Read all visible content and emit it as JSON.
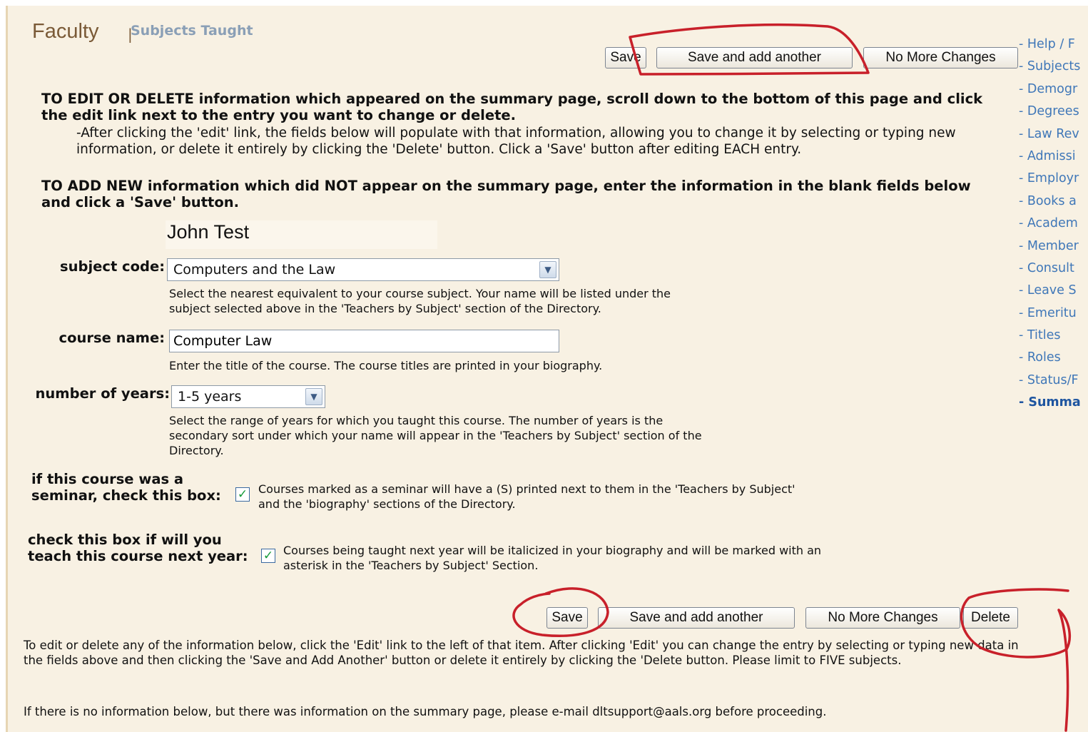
{
  "header": {
    "title": "Faculty",
    "separator": "|",
    "subtitle": "Subjects Taught"
  },
  "top_buttons": {
    "save": "Save",
    "save_add": "Save and add another",
    "no_more": "No More Changes"
  },
  "instructions": {
    "edit_bold": "TO EDIT OR DELETE information which appeared on the summary page, scroll down to the bottom of this page and click the edit link next to the entry you want to change or delete.",
    "edit_detail": "-After clicking the 'edit' link, the fields below will populate with that information, allowing you to change it by selecting or typing new information, or delete it entirely by clicking the 'Delete' button. Click a 'Save' button after editing EACH entry.",
    "add_bold": "TO ADD NEW information which did NOT appear on the summary page, enter the information in the blank fields below and click a 'Save' button."
  },
  "person_name": "John Test",
  "form": {
    "subject_code": {
      "label": "subject code:",
      "value": "Computers and the Law",
      "help": "Select the nearest equivalent to your course subject. Your name will be listed under the subject selected above in the 'Teachers by Subject' section of the Directory."
    },
    "course_name": {
      "label": "course name:",
      "value": "Computer Law",
      "help": "Enter the title of the course. The course titles are printed in your biography."
    },
    "years": {
      "label": "number of years:",
      "value": "1-5 years",
      "help": "Select the range of years for which you taught this course. The number of years is the secondary sort under which your name will appear in the 'Teachers by Subject' section of the Directory."
    },
    "seminar": {
      "label_line1": "if this course was a",
      "label_line2": "seminar, check this box:",
      "checked": true,
      "help": "Courses marked as a seminar will have a (S) printed next to them in the 'Teachers by Subject' and the 'biography' sections of the Directory."
    },
    "next_year": {
      "label_line1": "check this box if will you",
      "label_line2": "teach this course next year:",
      "checked": true,
      "help": "Courses being taught next year will be italicized in your biography and will be marked with an asterisk in the 'Teachers by Subject' Section."
    }
  },
  "bottom_buttons": {
    "save": "Save",
    "save_add": "Save and add another",
    "no_more": "No More Changes",
    "delete": "Delete"
  },
  "footer": {
    "edit_note": "To edit or delete any of the information below, click the 'Edit' link to the left of that item. After clicking 'Edit' you can change the entry by selecting or typing new data in the fields above and then clicking the 'Save and Add Another' button or delete it entirely by clicking the 'Delete button. Please limit to FIVE subjects.",
    "email_note": "If there is no information below, but there was information on the summary page, please e-mail dltsupport@aals.org before proceeding."
  },
  "sidebar": {
    "items": [
      {
        "label": "- Help / F"
      },
      {
        "label": "- Subjects"
      },
      {
        "label": "- Demogr"
      },
      {
        "label": "- Degrees"
      },
      {
        "label": "- Law Rev"
      },
      {
        "label": "- Admissi"
      },
      {
        "label": "- Employr"
      },
      {
        "label": "- Books a"
      },
      {
        "label": "- Academ"
      },
      {
        "label": "- Member"
      },
      {
        "label": "- Consult"
      },
      {
        "label": "- Leave S"
      },
      {
        "label": "- Emeritu"
      },
      {
        "label": "- Titles"
      },
      {
        "label": "- Roles"
      },
      {
        "label": "- Status/F"
      },
      {
        "label": "- Summa"
      }
    ]
  },
  "colors": {
    "background": "#f8f1e3",
    "title": "#7a5a37",
    "subtitle": "#8a9fb6",
    "nav_link": "#3f77b8",
    "annotation": "#c8202a",
    "checkmark": "#159a38"
  },
  "icons": {
    "select_arrow": "chevron-down-icon",
    "checkbox": "checkmark-icon"
  }
}
